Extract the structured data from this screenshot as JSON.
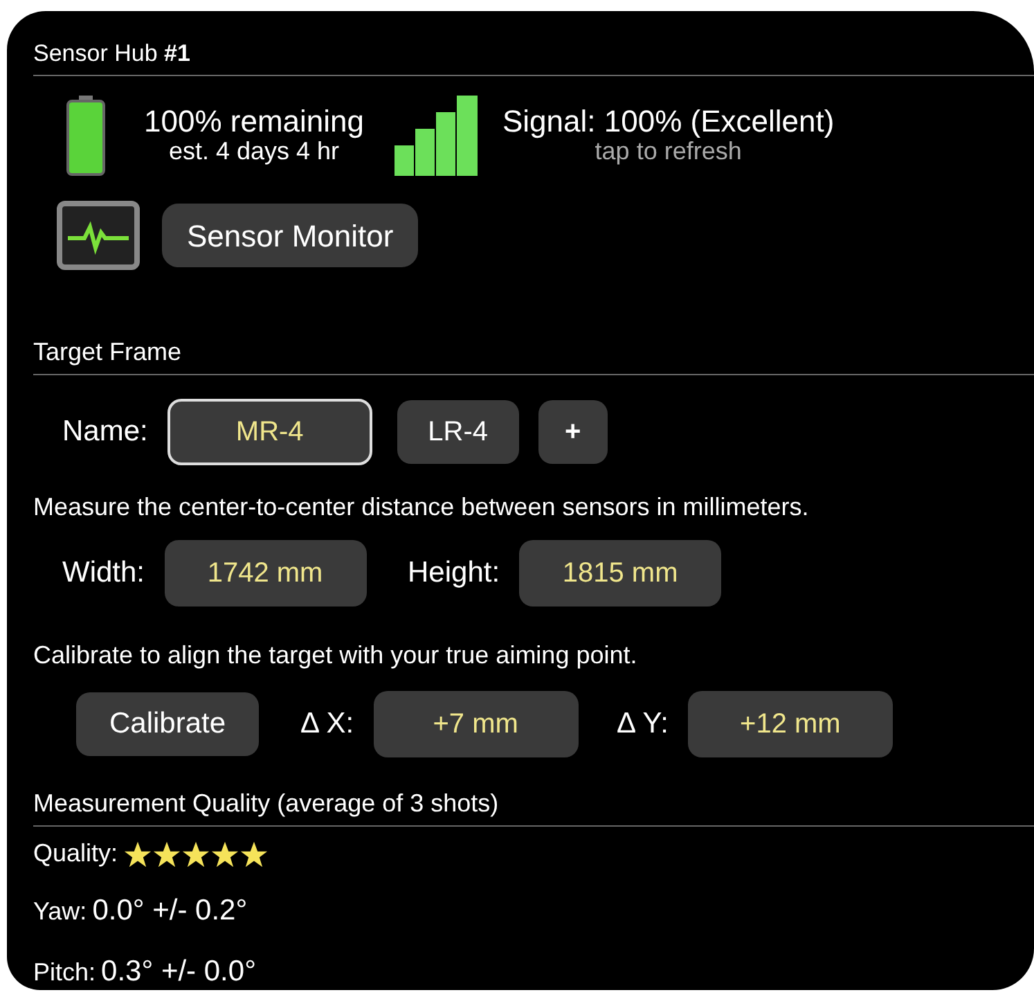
{
  "hub": {
    "title": "Sensor Hub **#1**"
  },
  "battery": {
    "remaining": "100% remaining",
    "estimate": "est. 4 days 4 hr"
  },
  "signal": {
    "text": "Signal: 100% (Excellent)",
    "hint": "tap to refresh"
  },
  "monitor_button": "Sensor Monitor",
  "target_frame": {
    "title": "Target Frame",
    "name_label": "Name:",
    "names": [
      {
        "label": "MR-4",
        "selected": true
      },
      {
        "label": "LR-4",
        "selected": false
      }
    ],
    "add_button": "+",
    "measure_hint": "Measure the center-to-center distance between sensors in millimeters.",
    "width_label": "Width:",
    "width_value": "1742 mm",
    "height_label": "Height:",
    "height_value": "1815 mm",
    "calibrate_hint": "Calibrate to align the target with your true aiming point.",
    "calibrate_button": "Calibrate",
    "dx_label": "Δ X:",
    "dx_value": "+7 mm",
    "dy_label": "Δ Y:",
    "dy_value": "+12 mm"
  },
  "quality": {
    "title": "Measurement Quality (average of 3 shots)",
    "quality_label": "Quality:",
    "stars": 5,
    "rows": [
      {
        "label": "Yaw:",
        "value": "0.0° +/- 0.2°"
      },
      {
        "label": "Pitch:",
        "value": "0.3° +/- 0.0°"
      }
    ]
  }
}
